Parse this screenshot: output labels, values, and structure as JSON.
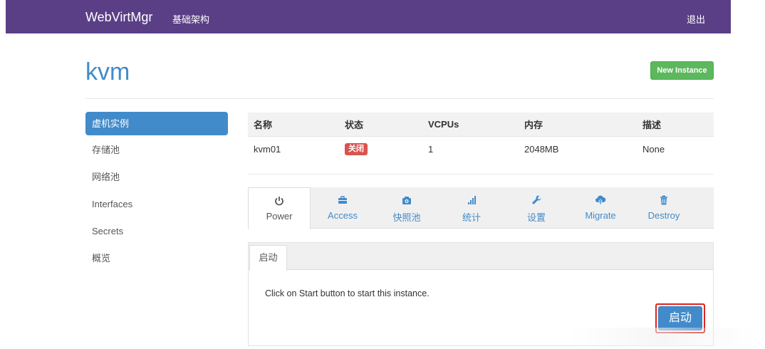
{
  "navbar": {
    "brand": "WebVirtMgr",
    "link": "基础架构",
    "logout": "退出"
  },
  "header": {
    "title": "kvm",
    "new_instance": "New Instance"
  },
  "sidebar": {
    "items": [
      {
        "label": "虚机实例"
      },
      {
        "label": "存储池"
      },
      {
        "label": "网络池"
      },
      {
        "label": "Interfaces"
      },
      {
        "label": "Secrets"
      },
      {
        "label": "概览"
      }
    ]
  },
  "table": {
    "headers": [
      "名称",
      "状态",
      "VCPUs",
      "内存",
      "描述"
    ],
    "rows": [
      {
        "name": "kvm01",
        "status": "关闭",
        "vcpus": "1",
        "memory": "2048MB",
        "desc": "None"
      }
    ]
  },
  "tabs": [
    {
      "label": "Power",
      "icon": "power-icon"
    },
    {
      "label": "Access",
      "icon": "briefcase-icon"
    },
    {
      "label": "快照池",
      "icon": "camera-icon"
    },
    {
      "label": "统计",
      "icon": "stats-icon"
    },
    {
      "label": "设置",
      "icon": "wrench-icon"
    },
    {
      "label": "Migrate",
      "icon": "cloud-upload-icon"
    },
    {
      "label": "Destroy",
      "icon": "trash-icon"
    }
  ],
  "start_panel": {
    "tab": "启动",
    "message": "Click on Start button to start this instance.",
    "button": "启动"
  },
  "colors": {
    "navbar": "#5b3f86",
    "primary": "#428bca",
    "success": "#5cb85c",
    "danger": "#d9534f"
  }
}
